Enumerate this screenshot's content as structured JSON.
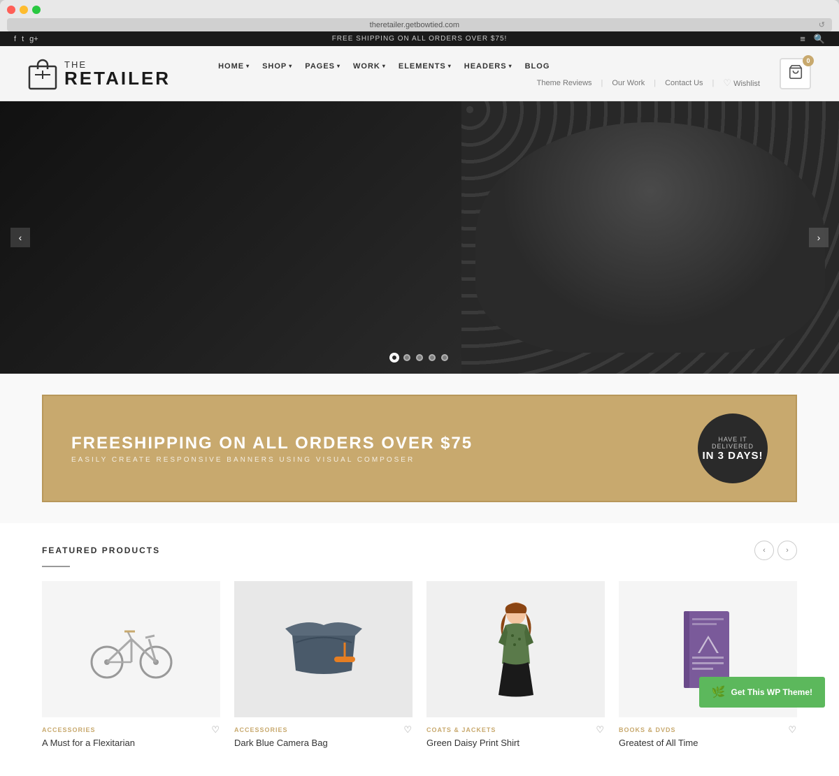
{
  "browser": {
    "url": "theretailer.getbowtied.com",
    "refresh_icon": "↺",
    "new_tab": "+"
  },
  "topbar": {
    "message": "FREE SHIPPING ON ALL ORDERS OVER $75!",
    "social": [
      "f",
      "t",
      "g+"
    ],
    "icons": [
      "≡",
      "🔍"
    ]
  },
  "logo": {
    "the": "THE",
    "retailer": "RETAILER"
  },
  "nav": {
    "main_items": [
      {
        "label": "HOME",
        "has_dropdown": true
      },
      {
        "label": "SHOP",
        "has_dropdown": true
      },
      {
        "label": "PAGES",
        "has_dropdown": true
      },
      {
        "label": "WORK",
        "has_dropdown": true
      },
      {
        "label": "ELEMENTS",
        "has_dropdown": true
      },
      {
        "label": "HEADERS",
        "has_dropdown": true
      },
      {
        "label": "BLOG",
        "has_dropdown": false
      }
    ],
    "sub_items": [
      {
        "label": "Theme Reviews"
      },
      {
        "label": "Our Work"
      },
      {
        "label": "Contact Us"
      },
      {
        "label": "♡ Wishlist"
      }
    ]
  },
  "cart": {
    "badge": "0",
    "icon": "🛍"
  },
  "hero": {
    "dots": [
      true,
      false,
      false,
      false,
      false
    ],
    "arrow_left": "‹",
    "arrow_right": "›"
  },
  "banner": {
    "title_prefix": "FREESHIPPING ON ALL ORDERS OVER ",
    "title_amount": "$75",
    "subtitle": "EASILY CREATE RESPONSIVE BANNERS USING VISUAL COMPOSER",
    "circle_top": "HAVE IT DELIVERED",
    "circle_main": "IN 3 DAYS!"
  },
  "featured_products": {
    "section_title": "FEATURED PRODUCTS",
    "products": [
      {
        "category": "ACCESSORIES",
        "name": "A Must for a Flexitarian",
        "image_type": "bike"
      },
      {
        "category": "ACCESSORIES",
        "name": "Dark Blue Camera Bag",
        "image_type": "bag"
      },
      {
        "category": "COATS & JACKETS",
        "name": "Green Daisy Print Shirt",
        "image_type": "shirt"
      },
      {
        "category": "BOOKS & DVDS",
        "name": "Greatest of All Time",
        "image_type": "book"
      }
    ]
  },
  "cta": {
    "label": "Get This WP Theme!",
    "icon": "🌿"
  }
}
